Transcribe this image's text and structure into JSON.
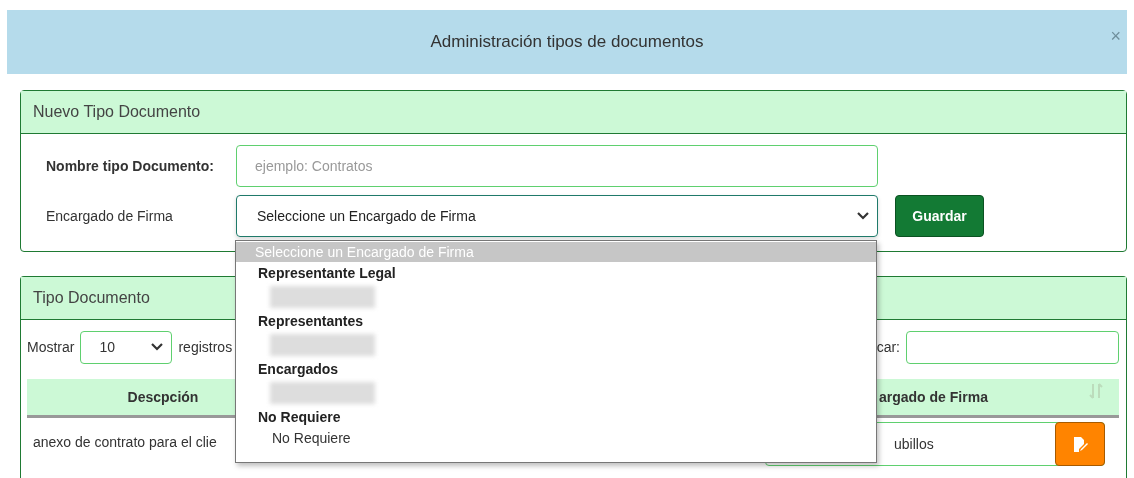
{
  "modal": {
    "title": "Administración tipos de documentos",
    "close": "×"
  },
  "new_panel": {
    "title": "Nuevo Tipo Documento",
    "name_field": {
      "label": "Nombre tipo Documento:",
      "placeholder": "ejemplo: Contratos"
    },
    "signer_field": {
      "label": "Encargado de Firma",
      "value": "Seleccione un Encargado de Firma",
      "expanded": true
    },
    "save_button": "Guardar"
  },
  "dropdown": {
    "options": [
      {
        "kind": "option",
        "label": "Seleccione un Encargado de Firma",
        "selected": true
      },
      {
        "kind": "group",
        "label": "Representante Legal"
      },
      {
        "kind": "redacted",
        "selected": false
      },
      {
        "kind": "group",
        "label": "Representantes"
      },
      {
        "kind": "redacted",
        "selected": false
      },
      {
        "kind": "group",
        "label": "Encargados"
      },
      {
        "kind": "redacted",
        "selected": false
      },
      {
        "kind": "group",
        "label": "No Requiere"
      },
      {
        "kind": "option",
        "label": "No Requiere",
        "selected": false
      }
    ]
  },
  "list_panel": {
    "title": "Tipo Documento",
    "show_label": "Mostrar",
    "page_size": "10",
    "records_label": "registros",
    "search_label": "car:",
    "columns": [
      {
        "label": "Descpción"
      },
      {
        "label": "argado de Firma",
        "sortable": true
      }
    ],
    "rows": [
      {
        "description": "anexo de contrato para el clie",
        "signer": "ubillos"
      }
    ]
  }
}
